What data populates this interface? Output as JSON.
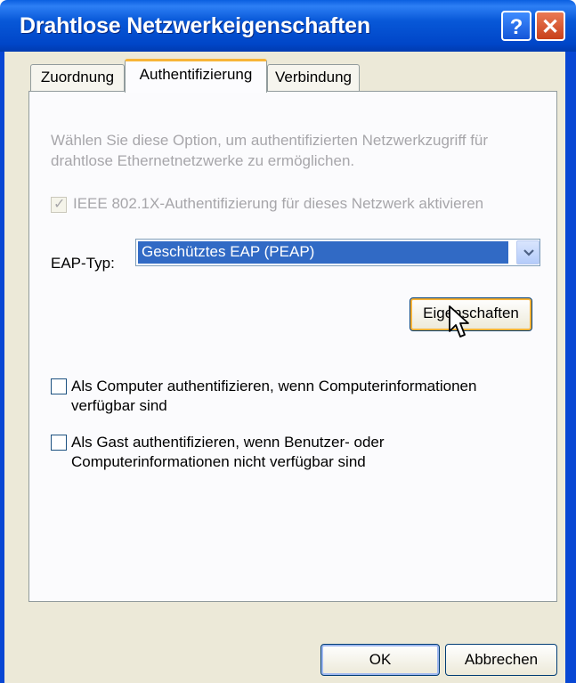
{
  "window": {
    "title": "Drahtlose Netzwerkeigenschaften",
    "help_button": "?",
    "close_button": "✕"
  },
  "tabs": [
    {
      "label": "Zuordnung",
      "selected": false
    },
    {
      "label": "Authentifizierung",
      "selected": true
    },
    {
      "label": "Verbindung",
      "selected": false
    }
  ],
  "auth": {
    "description_line1": "Wählen Sie diese Option, um authentifizierten Netzwerkzugriff für",
    "description_line2": "drahtlose Ethernetnetzwerke zu ermöglichen.",
    "ieee_label": "IEEE 802.1X-Authentifizierung für dieses Netzwerk aktivieren",
    "ieee_checked": true,
    "ieee_enabled": false,
    "eap_label": "EAP-Typ:",
    "eap_value": "Geschütztes EAP (PEAP)",
    "properties_button": "Eigenschaften",
    "computer_auth_line1": "Als Computer authentifizieren, wenn Computerinformationen",
    "computer_auth_line2": "verfügbar sind",
    "computer_auth_checked": false,
    "guest_auth_line1": "Als Gast authentifizieren, wenn Benutzer- oder",
    "guest_auth_line2": "Computerinformationen nicht verfügbar sind",
    "guest_auth_checked": false
  },
  "footer": {
    "ok_label": "OK",
    "cancel_label": "Abbrechen"
  },
  "colors": {
    "titlebar": "#0058e6",
    "selection": "#316ac5",
    "tab_highlight": "#f7b538",
    "disabled_text": "#a7a6aa"
  }
}
